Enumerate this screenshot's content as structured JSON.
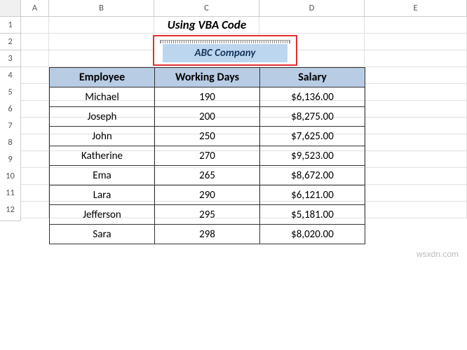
{
  "columns": [
    "A",
    "B",
    "C",
    "D",
    "E"
  ],
  "rows": [
    "1",
    "2",
    "3",
    "4",
    "5",
    "6",
    "7",
    "8",
    "9",
    "10",
    "11",
    "12"
  ],
  "title": "Using VBA Code",
  "textbox": {
    "text": "ABC Company"
  },
  "table": {
    "headers": [
      "Employee",
      "Working Days",
      "Salary"
    ],
    "data": [
      {
        "employee": "Michael",
        "days": "190",
        "salary": "$6,136.00"
      },
      {
        "employee": "Joseph",
        "days": "200",
        "salary": "$8,275.00"
      },
      {
        "employee": "John",
        "days": "250",
        "salary": "$7,625.00"
      },
      {
        "employee": "Katherine",
        "days": "270",
        "salary": "$9,523.00"
      },
      {
        "employee": "Ema",
        "days": "265",
        "salary": "$8,672.00"
      },
      {
        "employee": "Lara",
        "days": "290",
        "salary": "$6,121.00"
      },
      {
        "employee": "Jefferson",
        "days": "295",
        "salary": "$5,181.00"
      },
      {
        "employee": "Sara",
        "days": "298",
        "salary": "$8,020.00"
      }
    ]
  },
  "watermark": "wsxdn.com"
}
